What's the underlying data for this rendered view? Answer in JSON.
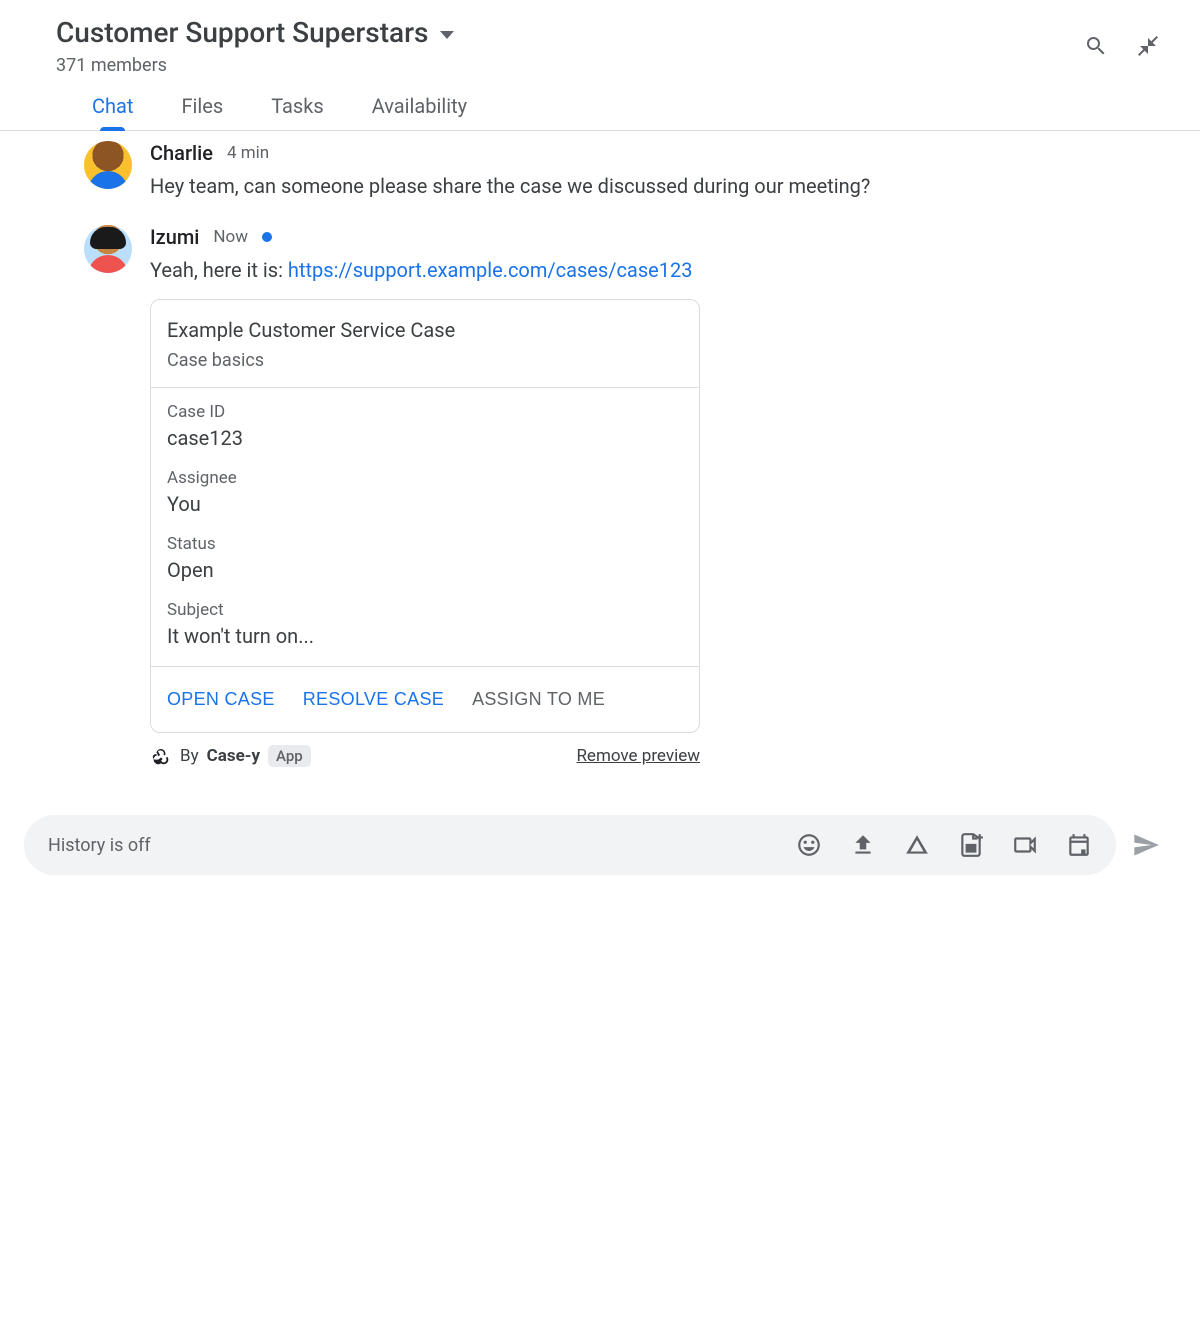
{
  "header": {
    "title": "Customer Support Superstars",
    "member_count": "371 members"
  },
  "tabs": [
    {
      "label": "Chat",
      "active": true
    },
    {
      "label": "Files",
      "active": false
    },
    {
      "label": "Tasks",
      "active": false
    },
    {
      "label": "Availability",
      "active": false
    }
  ],
  "messages": [
    {
      "author": "Charlie",
      "time": "4 min",
      "text_pre": "Hey team, can someone please share the case we discussed during our meeting?",
      "link": "",
      "show_status_dot": false
    },
    {
      "author": "Izumi",
      "time": "Now",
      "text_pre": "Yeah, here it is: ",
      "link": "https://support.example.com/cases/case123",
      "show_status_dot": true
    }
  ],
  "card": {
    "title": "Example Customer Service Case",
    "subtitle": "Case basics",
    "fields": [
      {
        "label": "Case ID",
        "value": "case123"
      },
      {
        "label": "Assignee",
        "value": "You"
      },
      {
        "label": "Status",
        "value": "Open"
      },
      {
        "label": "Subject",
        "value": "It won't turn on..."
      }
    ],
    "actions": [
      {
        "label": "OPEN CASE",
        "disabled": false
      },
      {
        "label": "RESOLVE CASE",
        "disabled": false
      },
      {
        "label": "ASSIGN TO ME",
        "disabled": true
      }
    ]
  },
  "preview_footer": {
    "by_prefix": "By ",
    "bot_name": "Case-y",
    "app_badge": "App",
    "remove_label": "Remove preview"
  },
  "composer": {
    "placeholder": "History is off"
  }
}
